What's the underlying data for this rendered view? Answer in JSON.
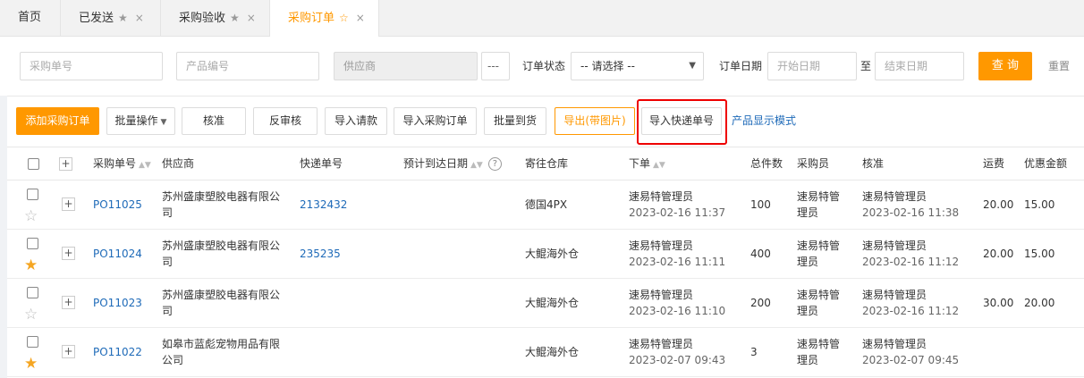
{
  "tabs": [
    {
      "label": "首页",
      "star": false,
      "close": false
    },
    {
      "label": "已发送",
      "star": true,
      "close": true
    },
    {
      "label": "采购验收",
      "star": true,
      "close": true
    },
    {
      "label": "采购订单",
      "star": true,
      "close": true,
      "active": true
    }
  ],
  "icons": {
    "star": "★",
    "star_outline": "☆",
    "close": "×",
    "caret": "▼",
    "plus": "+",
    "sort": "▲▼",
    "help": "?"
  },
  "colors": {
    "accent": "#ff9800",
    "link": "#1e6ab8",
    "highlight": "#e00000"
  },
  "filter": {
    "po_placeholder": "采购单号",
    "product_placeholder": "产品编号",
    "supplier_placeholder": "供应商",
    "more_label": "---",
    "status_label": "订单状态",
    "status_value": "-- 请选择 --",
    "date_label": "订单日期",
    "start_placeholder": "开始日期",
    "to_label": "至",
    "end_placeholder": "结束日期",
    "query_label": "查 询",
    "reset_label": "重置"
  },
  "toolbar": {
    "add_label": "添加采购订单",
    "batch_label": "批量操作",
    "approve_label": "核准",
    "unapprove_label": "反审核",
    "import_payment_label": "导入请款",
    "import_po_label": "导入采购订单",
    "batch_arrival_label": "批量到货",
    "export_images_label": "导出(带图片)",
    "import_tracking_label": "导入快递单号",
    "display_mode_label": "产品显示模式"
  },
  "table": {
    "headers": {
      "plus": "+",
      "po": "采购单号",
      "supplier": "供应商",
      "tracking": "快递单号",
      "eta": "预计到达日期",
      "warehouse": "寄往仓库",
      "order": "下单",
      "total": "总件数",
      "buyer": "采购员",
      "approve": "核准",
      "freight": "运费",
      "discount": "优惠金额"
    },
    "rows": [
      {
        "starred": false,
        "po": "PO11025",
        "supplier1": "苏州盛康塑胶电器有限公",
        "supplier2": "司",
        "tracking": "2132432",
        "warehouse": "德国4PX",
        "order_user": "速易特管理员",
        "order_time": "2023-02-16 11:37",
        "total": "100",
        "buyer1": "速易特管",
        "buyer2": "理员",
        "approve_user": "速易特管理员",
        "approve_time": "2023-02-16 11:38",
        "freight": "20.00",
        "discount": "15.00"
      },
      {
        "starred": true,
        "po": "PO11024",
        "supplier1": "苏州盛康塑胶电器有限公",
        "supplier2": "司",
        "tracking": "235235",
        "warehouse": "大鲲海外仓",
        "order_user": "速易特管理员",
        "order_time": "2023-02-16 11:11",
        "total": "400",
        "buyer1": "速易特管",
        "buyer2": "理员",
        "approve_user": "速易特管理员",
        "approve_time": "2023-02-16 11:12",
        "freight": "20.00",
        "discount": "15.00"
      },
      {
        "starred": false,
        "po": "PO11023",
        "supplier1": "苏州盛康塑胶电器有限公",
        "supplier2": "司",
        "tracking": "",
        "warehouse": "大鲲海外仓",
        "order_user": "速易特管理员",
        "order_time": "2023-02-16 11:10",
        "total": "200",
        "buyer1": "速易特管",
        "buyer2": "理员",
        "approve_user": "速易特管理员",
        "approve_time": "2023-02-16 11:12",
        "freight": "30.00",
        "discount": "20.00"
      },
      {
        "starred": true,
        "po": "PO11022",
        "supplier1": "如皋市蓝彪宠物用品有限",
        "supplier2": "公司",
        "tracking": "",
        "warehouse": "大鲲海外仓",
        "order_user": "速易特管理员",
        "order_time": "2023-02-07 09:43",
        "total": "3",
        "buyer1": "速易特管",
        "buyer2": "理员",
        "approve_user": "速易特管理员",
        "approve_time": "2023-02-07 09:45",
        "freight": "",
        "discount": ""
      }
    ]
  }
}
